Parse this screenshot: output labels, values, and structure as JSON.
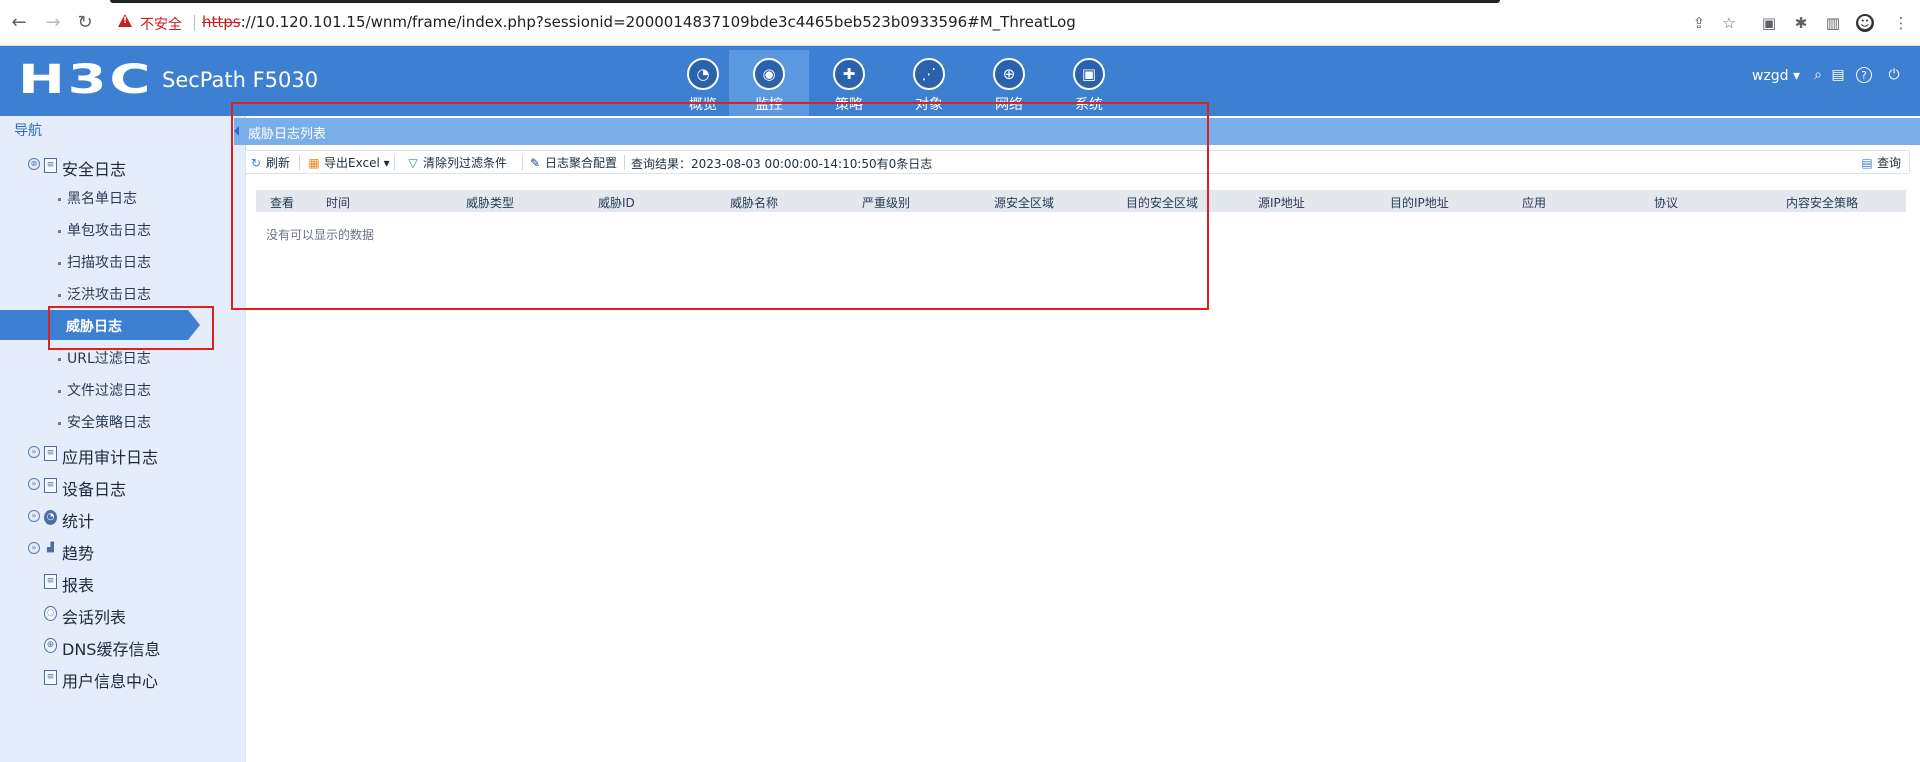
{
  "browser": {
    "insecure_label": "不安全",
    "url_scheme": "https",
    "url_rest": "://10.120.101.15/wnm/frame/index.php?sessionid=2000014837109bde3c4465beb523b0933596#M_ThreatLog"
  },
  "header": {
    "logo": "H3C",
    "product": "SecPath F5030",
    "user": "wzgd ▾",
    "top_nav": [
      {
        "label": "概览",
        "icon": "dashboard-icon",
        "glyph": "◔"
      },
      {
        "label": "监控",
        "icon": "monitor-icon",
        "glyph": "◉"
      },
      {
        "label": "策略",
        "icon": "shield-icon",
        "glyph": "✚"
      },
      {
        "label": "对象",
        "icon": "share-icon",
        "glyph": "⋰"
      },
      {
        "label": "网络",
        "icon": "globe-icon",
        "glyph": "⊕"
      },
      {
        "label": "系统",
        "icon": "screen-icon",
        "glyph": "▣"
      }
    ]
  },
  "sidebar": {
    "title": "导航",
    "security_log": "安全日志",
    "sub_items": [
      "黑名单日志",
      "单包攻击日志",
      "扫描攻击日志",
      "泛洪攻击日志",
      "威胁日志",
      "URL过滤日志",
      "文件过滤日志",
      "安全策略日志"
    ],
    "groups": [
      "应用审计日志",
      "设备日志",
      "统计",
      "趋势"
    ],
    "others": [
      "报表",
      "会话列表",
      "DNS缓存信息",
      "用户信息中心"
    ]
  },
  "panel": {
    "title": "威胁日志列表",
    "toolbar": {
      "refresh": "刷新",
      "export": "导出Excel ▾",
      "clear_filter": "清除列过滤条件",
      "aggregate": "日志聚合配置",
      "query_result": "查询结果：2023-08-03 00:00:00-14:10:50有0条日志",
      "query": "查询"
    },
    "columns": [
      "查看",
      "时间",
      "威胁类型",
      "威胁ID",
      "威胁名称",
      "严重级别",
      "源安全区域",
      "目的安全区域",
      "源IP地址",
      "目的IP地址",
      "应用",
      "协议",
      "内容安全策略"
    ],
    "empty_text": "没有可以显示的数据"
  }
}
